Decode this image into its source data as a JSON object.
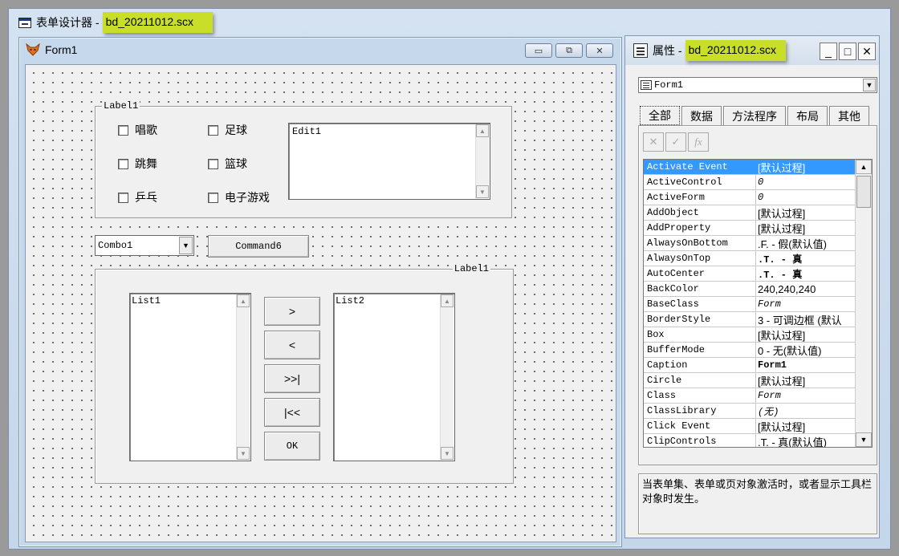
{
  "main_window": {
    "title_prefix": "表单设计器 - ",
    "file_name": "bd_20211012.scx"
  },
  "form_window": {
    "title": "Form1",
    "buttons": {
      "minimize": "▭",
      "restore": "⧉",
      "close": "✕"
    }
  },
  "form": {
    "group1_label": "Label1",
    "checkboxes": [
      "唱歌",
      "足球",
      "跳舞",
      "篮球",
      "乒乓",
      "电子游戏"
    ],
    "edit_label": "Edit1",
    "combo_label": "Combo1",
    "command_label": "Command6",
    "group2_label": "Label1",
    "list1_label": "List1",
    "list2_label": "List2",
    "move_buttons": [
      ">",
      "<",
      ">>|",
      "|<<",
      "OK"
    ]
  },
  "properties": {
    "title_prefix": "属性 - ",
    "file_name": "bd_20211012.scx",
    "object_name": "Form1",
    "tabs": [
      "全部",
      "数据",
      "方法程序",
      "布局",
      "其他"
    ],
    "tool_icons": [
      "cancel-icon",
      "accept-icon",
      "function-icon"
    ],
    "rows": [
      {
        "name": "Activate Event",
        "value": "[默认过程]"
      },
      {
        "name": "ActiveControl",
        "value": "0"
      },
      {
        "name": "ActiveForm",
        "value": "0"
      },
      {
        "name": "AddObject",
        "value": "[默认过程]"
      },
      {
        "name": "AddProperty",
        "value": "[默认过程]"
      },
      {
        "name": "AlwaysOnBottom",
        "value": ".F. - 假(默认值)"
      },
      {
        "name": "AlwaysOnTop",
        "value": ".T. - 真"
      },
      {
        "name": "AutoCenter",
        "value": ".T. - 真"
      },
      {
        "name": "BackColor",
        "value": "240,240,240"
      },
      {
        "name": "BaseClass",
        "value": "Form"
      },
      {
        "name": "BorderStyle",
        "value": "3 - 可调边框 (默认"
      },
      {
        "name": "Box",
        "value": "[默认过程]"
      },
      {
        "name": "BufferMode",
        "value": "0 - 无(默认值)"
      },
      {
        "name": "Caption",
        "value": "Form1"
      },
      {
        "name": "Circle",
        "value": "[默认过程]"
      },
      {
        "name": "Class",
        "value": "Form"
      },
      {
        "name": "ClassLibrary",
        "value": "(无)"
      },
      {
        "name": "Click Event",
        "value": "[默认过程]"
      },
      {
        "name": "ClipControls",
        "value": ".T. - 真(默认值)"
      }
    ],
    "description": "当表单集、表单或页对象激活时，或者显示工具栏对象时发生。"
  },
  "colors": {
    "highlight": "#c8de29",
    "selection": "#3399ff"
  }
}
